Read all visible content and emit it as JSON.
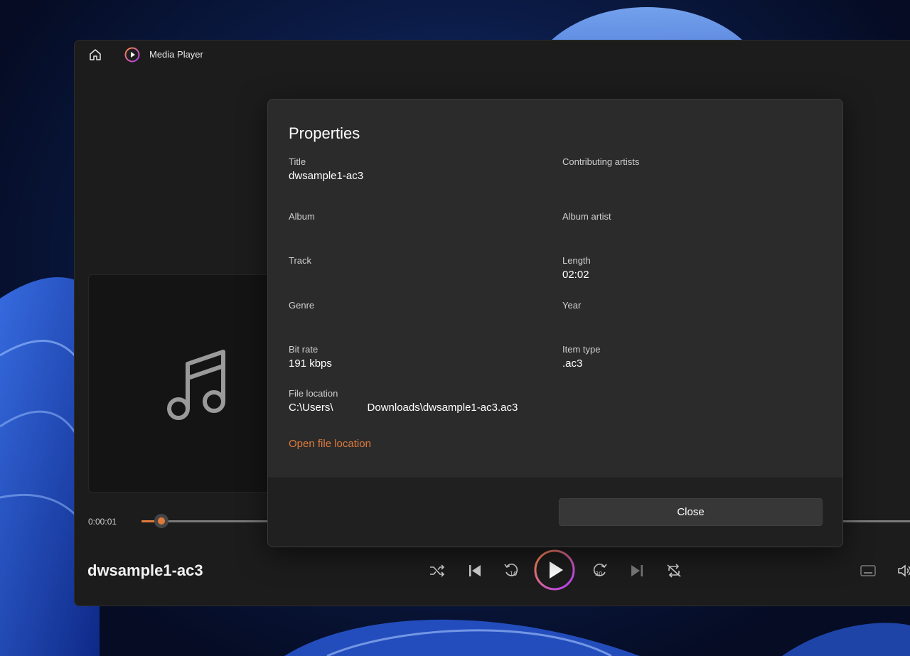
{
  "app": {
    "title": "Media Player",
    "accent_color": "#e07a3b"
  },
  "player": {
    "current_time": "0:00:01",
    "progress": 0.008,
    "now_playing_title": "dwsample1-ac3",
    "controls": [
      "shuffle-icon",
      "previous-icon",
      "rewind-10-icon",
      "play-icon",
      "forward-30-icon",
      "next-icon",
      "repeat-off-icon",
      "miniplayer-icon",
      "volume-icon"
    ]
  },
  "properties_dialog": {
    "title": "Properties",
    "fields": {
      "title": {
        "label": "Title",
        "value": "dwsample1-ac3"
      },
      "contributing_artists": {
        "label": "Contributing artists",
        "value": ""
      },
      "album": {
        "label": "Album",
        "value": ""
      },
      "album_artist": {
        "label": "Album artist",
        "value": ""
      },
      "track": {
        "label": "Track",
        "value": ""
      },
      "length": {
        "label": "Length",
        "value": "02:02"
      },
      "genre": {
        "label": "Genre",
        "value": ""
      },
      "year": {
        "label": "Year",
        "value": ""
      },
      "bit_rate": {
        "label": "Bit rate",
        "value": "191 kbps"
      },
      "item_type": {
        "label": "Item type",
        "value": ".ac3"
      },
      "file_location": {
        "label": "File location",
        "value_start": "C:\\Users\\",
        "value_end": "Downloads\\dwsample1-ac3.ac3"
      }
    },
    "open_file_location_label": "Open file location",
    "close_label": "Close"
  }
}
